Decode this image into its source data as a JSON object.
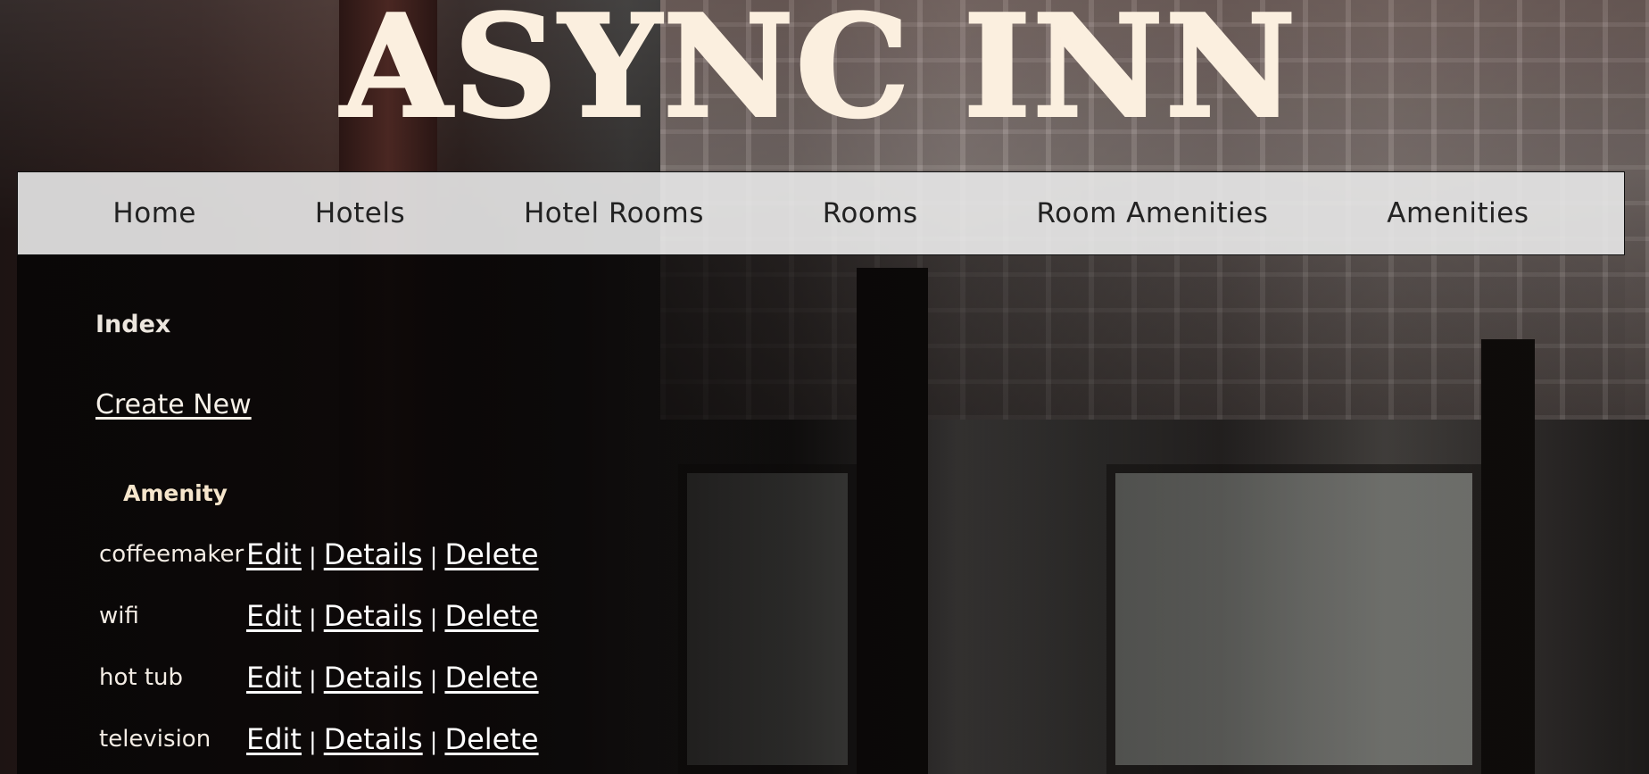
{
  "site": {
    "title": "ASYNC INN"
  },
  "nav": {
    "items": [
      {
        "label": "Home"
      },
      {
        "label": "Hotels"
      },
      {
        "label": "Hotel Rooms"
      },
      {
        "label": "Rooms"
      },
      {
        "label": "Room Amenities"
      },
      {
        "label": "Amenities"
      }
    ]
  },
  "main": {
    "heading": "Index",
    "create_label": "Create New",
    "table": {
      "header": "Amenity",
      "separator": "|",
      "rows": [
        {
          "name": "coffeemaker",
          "edit": "Edit",
          "details": "Details",
          "delete": "Delete"
        },
        {
          "name": "wifi",
          "edit": "Edit",
          "details": "Details",
          "delete": "Delete"
        },
        {
          "name": "hot tub",
          "edit": "Edit",
          "details": "Details",
          "delete": "Delete"
        },
        {
          "name": "television",
          "edit": "Edit",
          "details": "Details",
          "delete": "Delete"
        }
      ]
    }
  }
}
